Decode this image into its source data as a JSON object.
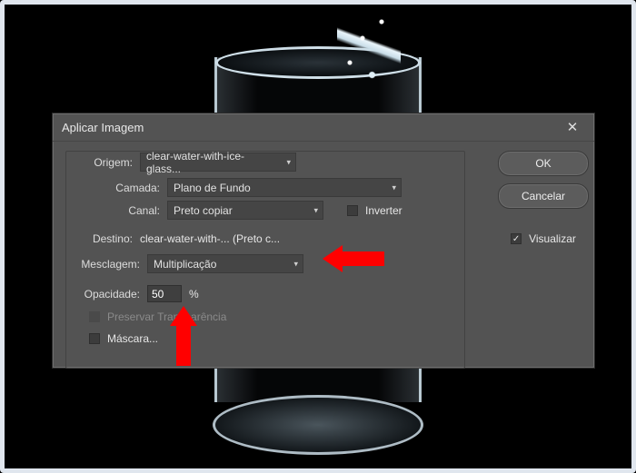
{
  "dialog": {
    "title": "Aplicar Imagem",
    "labels": {
      "origem": "Origem:",
      "camada": "Camada:",
      "canal": "Canal:",
      "inverter": "Inverter",
      "destino": "Destino:",
      "mesclagem": "Mesclagem:",
      "opacidade": "Opacidade:",
      "opacidade_unit": "%",
      "preservar": "Preservar Transparência",
      "mascara": "Máscara..."
    },
    "values": {
      "origem": "clear-water-with-ice-glass...",
      "camada": "Plano de Fundo",
      "canal": "Preto copiar",
      "destino": "clear-water-with-... (Preto c...",
      "mesclagem": "Multiplicação",
      "opacidade": "50",
      "inverter_checked": false,
      "preservar_checked": false,
      "mascara_checked": false,
      "visualizar_checked": true
    },
    "buttons": {
      "ok": "OK",
      "cancelar": "Cancelar",
      "visualizar": "Visualizar"
    }
  }
}
